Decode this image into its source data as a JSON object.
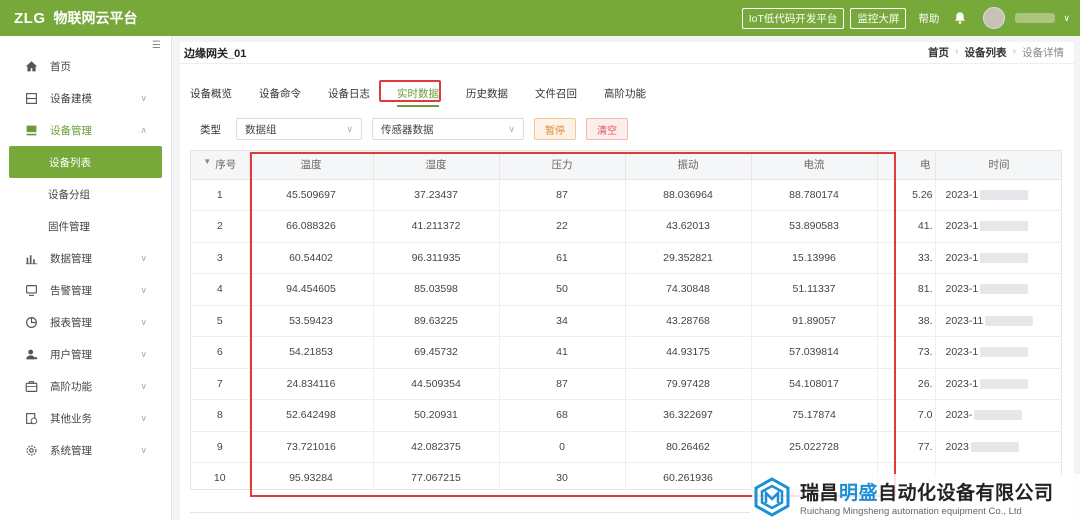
{
  "topbar": {
    "logo": "ZLG",
    "platform_name": "物联网云平台",
    "btn_iot": "IoT低代码开发平台",
    "btn_monitor": "监控大屏",
    "help": "帮助"
  },
  "sidebar": {
    "collapse": "☰",
    "items": [
      {
        "label": "首页"
      },
      {
        "label": "设备建模"
      },
      {
        "label": "设备管理"
      },
      {
        "label": "设备列表"
      },
      {
        "label": "设备分组"
      },
      {
        "label": "固件管理"
      },
      {
        "label": "数据管理"
      },
      {
        "label": "告警管理"
      },
      {
        "label": "报表管理"
      },
      {
        "label": "用户管理"
      },
      {
        "label": "高阶功能"
      },
      {
        "label": "其他业务"
      },
      {
        "label": "系统管理"
      }
    ]
  },
  "page": {
    "title": "边缘网关_01",
    "breadcrumb": [
      "首页",
      "设备列表",
      "设备详情"
    ]
  },
  "tabs": [
    "设备概览",
    "设备命令",
    "设备日志",
    "实时数据",
    "历史数据",
    "文件召回",
    "高阶功能"
  ],
  "filters": {
    "type_label": "类型",
    "type_value": "数据组",
    "sensor_value": "传感器数据",
    "pause": "暂停",
    "clear": "清空"
  },
  "table": {
    "headers": [
      "序号",
      "温度",
      "湿度",
      "压力",
      "振动",
      "电流",
      "电",
      "时间"
    ],
    "rows": [
      [
        "1",
        "45.509697",
        "37.23437",
        "87",
        "88.036964",
        "88.780174",
        "5.26",
        "2023-1"
      ],
      [
        "2",
        "66.088326",
        "41.211372",
        "22",
        "43.62013",
        "53.890583",
        "41.",
        "2023-1"
      ],
      [
        "3",
        "60.54402",
        "96.311935",
        "61",
        "29.352821",
        "15.13996",
        "33.",
        "2023-1"
      ],
      [
        "4",
        "94.454605",
        "85.03598",
        "50",
        "74.30848",
        "51.11337",
        "81.",
        "2023-1"
      ],
      [
        "5",
        "53.59423",
        "89.63225",
        "34",
        "43.28768",
        "91.89057",
        "38.",
        "2023-11"
      ],
      [
        "6",
        "54.21853",
        "69.45732",
        "41",
        "44.93175",
        "57.039814",
        "73.",
        "2023-1"
      ],
      [
        "7",
        "24.834116",
        "44.509354",
        "87",
        "79.97428",
        "54.108017",
        "26.",
        "2023-1"
      ],
      [
        "8",
        "52.642498",
        "50.20931",
        "68",
        "36.322697",
        "75.17874",
        "7.0",
        "2023-"
      ],
      [
        "9",
        "73.721016",
        "42.082375",
        "0",
        "80.26462",
        "25.022728",
        "77.",
        "2023"
      ],
      [
        "10",
        "95.93284",
        "77.067215",
        "30",
        "60.261936",
        "",
        "",
        ""
      ]
    ]
  },
  "watermark": {
    "cn_1": "瑞昌",
    "cn_2": "明盛",
    "cn_3": "自动化设备有限公司",
    "en": "Ruichang Mingsheng automation equipment Co., Ltd"
  },
  "colors": {
    "brand_green": "#76a83a",
    "highlight_red": "#e03b3b"
  }
}
